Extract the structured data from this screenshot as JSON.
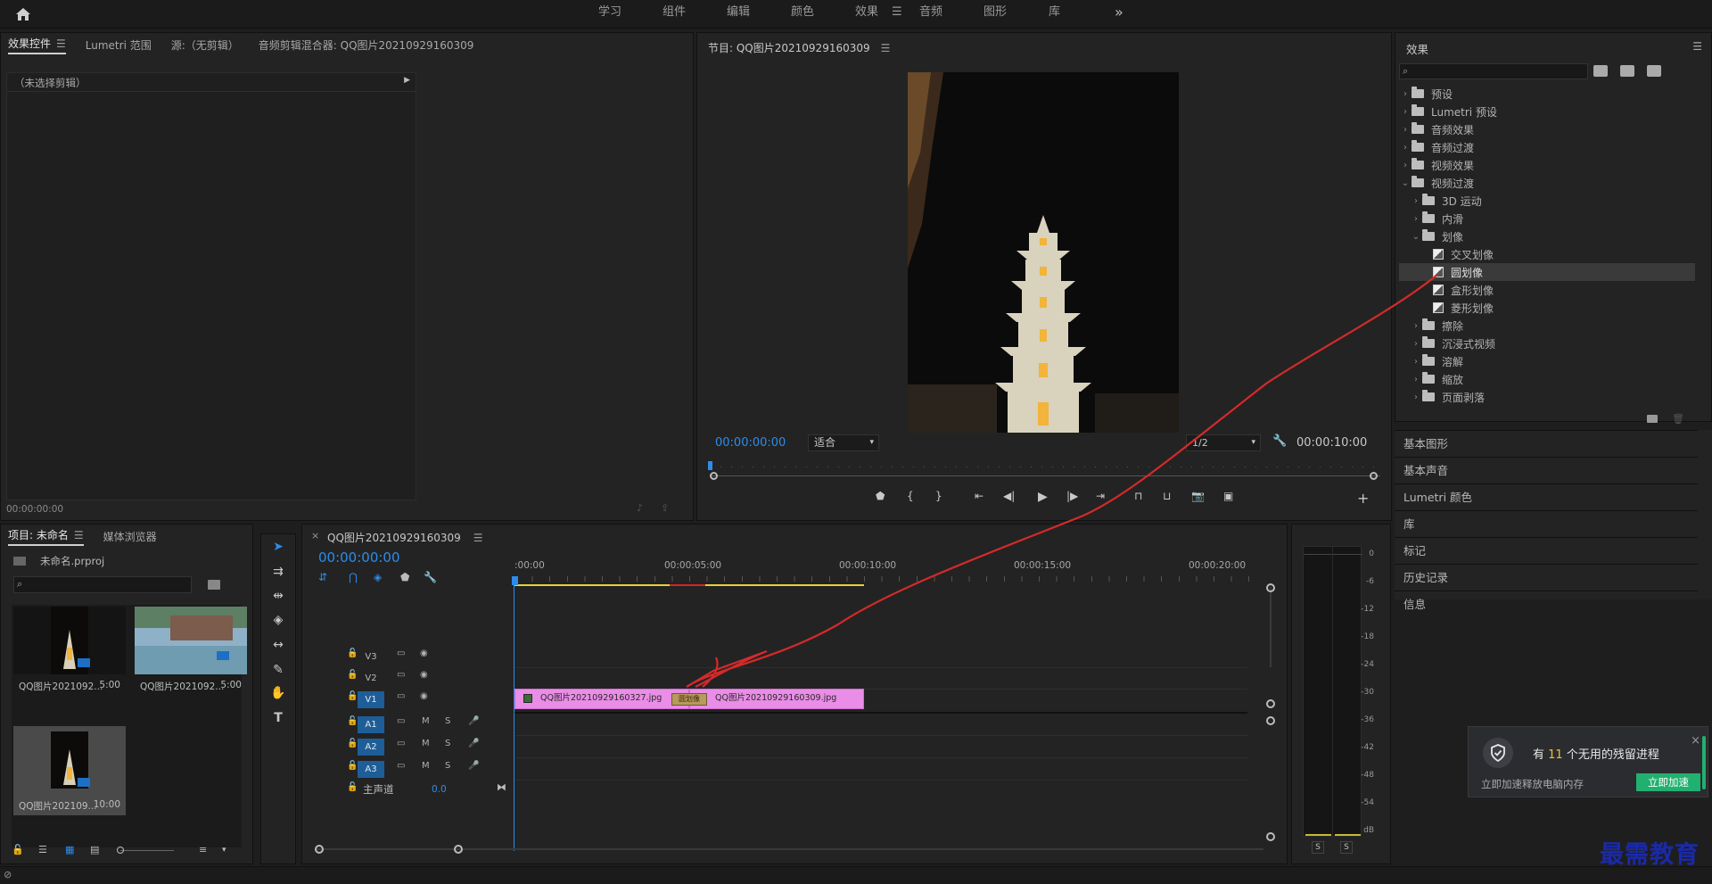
{
  "workspaces": {
    "home_icon": "home-icon",
    "items": [
      "学习",
      "组件",
      "编辑",
      "颜色",
      "效果",
      "音频",
      "图形",
      "库"
    ],
    "active_index": 4,
    "more": "»"
  },
  "source_panel": {
    "tabs": [
      "效果控件",
      "Lumetri 范围",
      "源:（无剪辑）",
      "音频剪辑混合器: QQ图片20210929160309"
    ],
    "no_clip_label": "（未选择剪辑）",
    "timecode": "00:00:00:00"
  },
  "program_monitor": {
    "title": "节目: QQ图片20210929160309",
    "timecode_left": "00:00:00:00",
    "fit_label": "适合",
    "quality": "1/2",
    "timecode_right": "00:00:10:00"
  },
  "effects_panel": {
    "title": "效果",
    "search_placeholder": "",
    "tree": [
      {
        "label": "预设",
        "level": 0,
        "type": "folder",
        "expanded": false
      },
      {
        "label": "Lumetri 预设",
        "level": 0,
        "type": "folder",
        "expanded": false
      },
      {
        "label": "音频效果",
        "level": 0,
        "type": "folder",
        "expanded": false
      },
      {
        "label": "音频过渡",
        "level": 0,
        "type": "folder",
        "expanded": false
      },
      {
        "label": "视频效果",
        "level": 0,
        "type": "folder",
        "expanded": false
      },
      {
        "label": "视频过渡",
        "level": 0,
        "type": "folder",
        "expanded": true
      },
      {
        "label": "3D 运动",
        "level": 1,
        "type": "folder",
        "expanded": false
      },
      {
        "label": "内滑",
        "level": 1,
        "type": "folder",
        "expanded": false
      },
      {
        "label": "划像",
        "level": 1,
        "type": "folder",
        "expanded": true
      },
      {
        "label": "交叉划像",
        "level": 2,
        "type": "fx"
      },
      {
        "label": "圆划像",
        "level": 2,
        "type": "fx",
        "selected": true
      },
      {
        "label": "盒形划像",
        "level": 2,
        "type": "fx"
      },
      {
        "label": "菱形划像",
        "level": 2,
        "type": "fx"
      },
      {
        "label": "擦除",
        "level": 1,
        "type": "folder",
        "expanded": false
      },
      {
        "label": "沉浸式视频",
        "level": 1,
        "type": "folder",
        "expanded": false
      },
      {
        "label": "溶解",
        "level": 1,
        "type": "folder",
        "expanded": false
      },
      {
        "label": "缩放",
        "level": 1,
        "type": "folder",
        "expanded": false
      },
      {
        "label": "页面剥落",
        "level": 1,
        "type": "folder",
        "expanded": false
      }
    ]
  },
  "side_panels": [
    "基本图形",
    "基本声音",
    "Lumetri 颜色",
    "库",
    "标记",
    "历史记录",
    "信息"
  ],
  "project_panel": {
    "tabs": [
      "项目: 未命名",
      "媒体浏览器"
    ],
    "project_file": "未命名.prproj",
    "items": [
      {
        "name": "QQ图片2021092...",
        "duration": "5:00"
      },
      {
        "name": "QQ图片2021092...",
        "duration": "5:00"
      },
      {
        "name": "QQ图片202109...",
        "duration": "10:00"
      }
    ]
  },
  "timeline": {
    "title": "QQ图片20210929160309",
    "timecode": "00:00:00:00",
    "ruler": [
      ":00:00",
      "00:00:05:00",
      "00:00:10:00",
      "00:00:15:00",
      "00:00:20:00"
    ],
    "video_tracks": [
      "V3",
      "V2",
      "V1"
    ],
    "audio_tracks": [
      "A1",
      "A2",
      "A3"
    ],
    "master_label": "主声道",
    "master_value": "0.0",
    "clips": [
      {
        "name": "QQ图片20210929160327.jpg"
      },
      {
        "name": "QQ图片20210929160309.jpg"
      }
    ],
    "transition_label": "圆划像"
  },
  "audio_meter": {
    "scale": [
      "0",
      "-6",
      "-12",
      "-18",
      "-24",
      "-30",
      "-36",
      "-42",
      "-48",
      "-54",
      "dB"
    ],
    "solo_labels": [
      "S",
      "S"
    ]
  },
  "notification": {
    "title_prefix": "有 ",
    "count": "11",
    "title_suffix": " 个无用的残留进程",
    "body": "立即加速释放电脑内存",
    "button": "立即加速"
  },
  "watermark": "最需教育",
  "colors": {
    "accent_blue": "#2d8ceb",
    "clip_pink": "#e98de6",
    "panel_bg": "#232323",
    "annotation_red": "#d42a2a",
    "notify_green": "#21b06f"
  }
}
